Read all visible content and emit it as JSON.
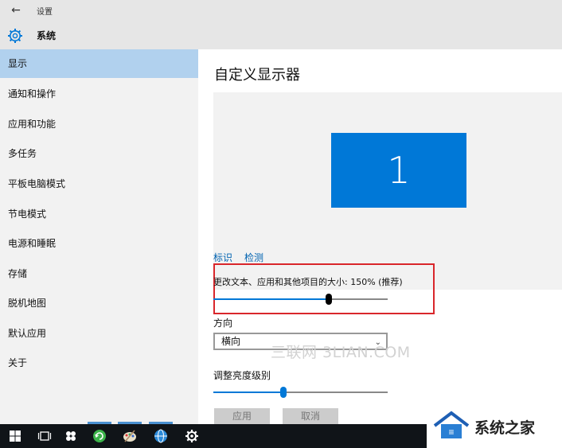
{
  "window": {
    "title": "设置"
  },
  "header": {
    "section": "系统"
  },
  "sidebar": {
    "items": [
      {
        "label": "显示"
      },
      {
        "label": "通知和操作"
      },
      {
        "label": "应用和功能"
      },
      {
        "label": "多任务"
      },
      {
        "label": "平板电脑模式"
      },
      {
        "label": "节电模式"
      },
      {
        "label": "电源和睡眠"
      },
      {
        "label": "存储"
      },
      {
        "label": "脱机地图"
      },
      {
        "label": "默认应用"
      },
      {
        "label": "关于"
      }
    ],
    "selected_index": 0
  },
  "main": {
    "title": "自定义显示器",
    "monitor_number": "1",
    "identify_link": "标识",
    "detect_link": "检测",
    "scale_label": "更改文本、应用和其他项目的大小: 150% (推荐)",
    "scale_slider_fraction": 0.66,
    "orientation_label": "方向",
    "orientation_value": "横向",
    "brightness_label": "调整亮度级别",
    "brightness_slider_fraction": 0.4,
    "apply_button": "应用",
    "cancel_button": "取消"
  },
  "watermark": "三联网 3LIAN.COM",
  "logo": {
    "text": "系统之家"
  },
  "taskbar": {
    "icons": [
      "windows-start-icon",
      "task-view-icon",
      "apps-icon",
      "refresh-app-icon",
      "paint-app-icon",
      "globe-app-icon",
      "settings-gear-icon"
    ]
  },
  "colors": {
    "accent": "#0078d7",
    "highlight_border": "#d9262b",
    "selected_nav": "#b1d1ee",
    "sidebar_bg": "#f2f2f2",
    "titlebar_bg": "#e6e6e6",
    "taskbar_bg": "#101418"
  }
}
